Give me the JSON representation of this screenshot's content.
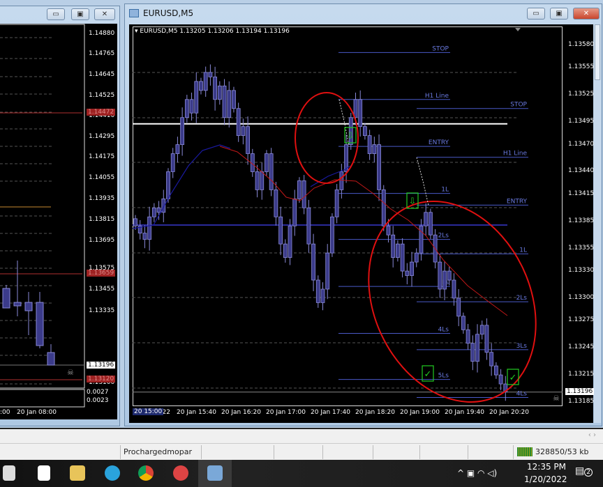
{
  "left_window": {
    "price_labels": [
      "1.14880",
      "1.14765",
      "1.14645",
      "1.14525",
      "1.14410",
      "1.14295",
      "1.14175",
      "1.14055",
      "1.13935",
      "1.13815",
      "1.13695",
      "1.13575",
      "1.13455",
      "1.13335",
      "1.13100"
    ],
    "red_tags": [
      "1.14472",
      "1.13659",
      "1.13120"
    ],
    "current_price": "1.13196",
    "indicator_labels": [
      "0.0027",
      "0.0023"
    ],
    "time_labels": [
      ":00",
      "20 Jan 08:00"
    ]
  },
  "main_window": {
    "title": "EURUSD,M5",
    "chart_header": "EURUSD,M5  1.13205 1.13206 1.13194 1.13196",
    "current_price": "1.13196",
    "time_highlight": "20 15:00",
    "time_labels": [
      "20 Jan 2022",
      "20 Jan 15:40",
      "20 Jan 16:20",
      "20 Jan 17:00",
      "20 Jan 17:40",
      "20 Jan 18:20",
      "20 Jan 19:00",
      "20 Jan 19:40",
      "20 Jan 20:20"
    ]
  },
  "chart_data": {
    "type": "candlestick",
    "symbol": "EURUSD",
    "timeframe": "M5",
    "ylim": [
      1.13185,
      1.1358
    ],
    "y_ticks": [
      "1.13580",
      "1.13555",
      "1.13525",
      "1.13495",
      "1.13470",
      "1.13440",
      "1.13415",
      "1.13385",
      "1.13355",
      "1.13330",
      "1.13300",
      "1.13275",
      "1.13245",
      "1.13215",
      "1.13185"
    ],
    "close": [
      1.1338,
      1.13372,
      1.13365,
      1.1339,
      1.134,
      1.13395,
      1.1341,
      1.1344,
      1.1346,
      1.1347,
      1.135,
      1.1352,
      1.13505,
      1.1354,
      1.1353,
      1.1355,
      1.13545,
      1.1352,
      1.13535,
      1.135,
      1.1353,
      1.1351,
      1.1348,
      1.1349,
      1.1346,
      1.1344,
      1.1342,
      1.1344,
      1.1346,
      1.1342,
      1.1339,
      1.1336,
      1.13345,
      1.1338,
      1.1341,
      1.1343,
      1.134,
      1.1336,
      1.1332,
      1.13295,
      1.1331,
      1.1335,
      1.1339,
      1.1342,
      1.1344,
      1.1347,
      1.135,
      1.1352,
      1.1349,
      1.1348,
      1.1346,
      1.1347,
      1.1342,
      1.1338,
      1.1337,
      1.13345,
      1.1336,
      1.1333,
      1.13325,
      1.1334,
      1.1335,
      1.1338,
      1.13395,
      1.1337,
      1.1334,
      1.1331,
      1.1333,
      1.1332,
      1.133,
      1.1328,
      1.13265,
      1.1325,
      1.1323,
      1.1326,
      1.1327,
      1.1324,
      1.13225,
      1.13215,
      1.13205,
      1.13196
    ],
    "levels": [
      {
        "label": "STOP",
        "price": 1.13572,
        "group": "a"
      },
      {
        "label": "H1 Line",
        "price": 1.1352,
        "group": "a"
      },
      {
        "label": "STOP",
        "price": 1.1351,
        "group": "b"
      },
      {
        "label": "ENTRY",
        "price": 1.13468,
        "group": "a"
      },
      {
        "label": "H1 Line",
        "price": 1.13456,
        "group": "b"
      },
      {
        "label": "1L",
        "price": 1.13416,
        "group": "a"
      },
      {
        "label": "ENTRY",
        "price": 1.13403,
        "group": "b"
      },
      {
        "label": "2Ls",
        "price": 1.13365,
        "group": "a"
      },
      {
        "label": "1L",
        "price": 1.13349,
        "group": "b"
      },
      {
        "label": "3Ls",
        "price": 1.13313,
        "group": "a"
      },
      {
        "label": "2Ls",
        "price": 1.13296,
        "group": "b"
      },
      {
        "label": "4Ls",
        "price": 1.13261,
        "group": "a"
      },
      {
        "label": "3Ls",
        "price": 1.13243,
        "group": "b"
      },
      {
        "label": "5Ls",
        "price": 1.1321,
        "group": "a"
      },
      {
        "label": "4Ls",
        "price": 1.1319,
        "group": "b"
      }
    ],
    "horizontal_lines": [
      {
        "price": 1.13493,
        "color": "#ffffff"
      },
      {
        "price": 1.13381,
        "color": "#2a2a9a"
      }
    ],
    "colors": {
      "candle": "#3b3b8a",
      "candle_border": "#8a8ad8",
      "level": "#4a5ac8",
      "ma_fast": "#1a1aa0",
      "ma_slow": "#c01818",
      "annotation": "#e01010",
      "signal": "#22cc22"
    }
  },
  "status_bar": {
    "profile": "Prochargedmopar",
    "traffic": "328850/53 kb"
  },
  "taskbar": {
    "time": "12:35 PM",
    "date": "1/20/2022",
    "notifications": "2"
  }
}
